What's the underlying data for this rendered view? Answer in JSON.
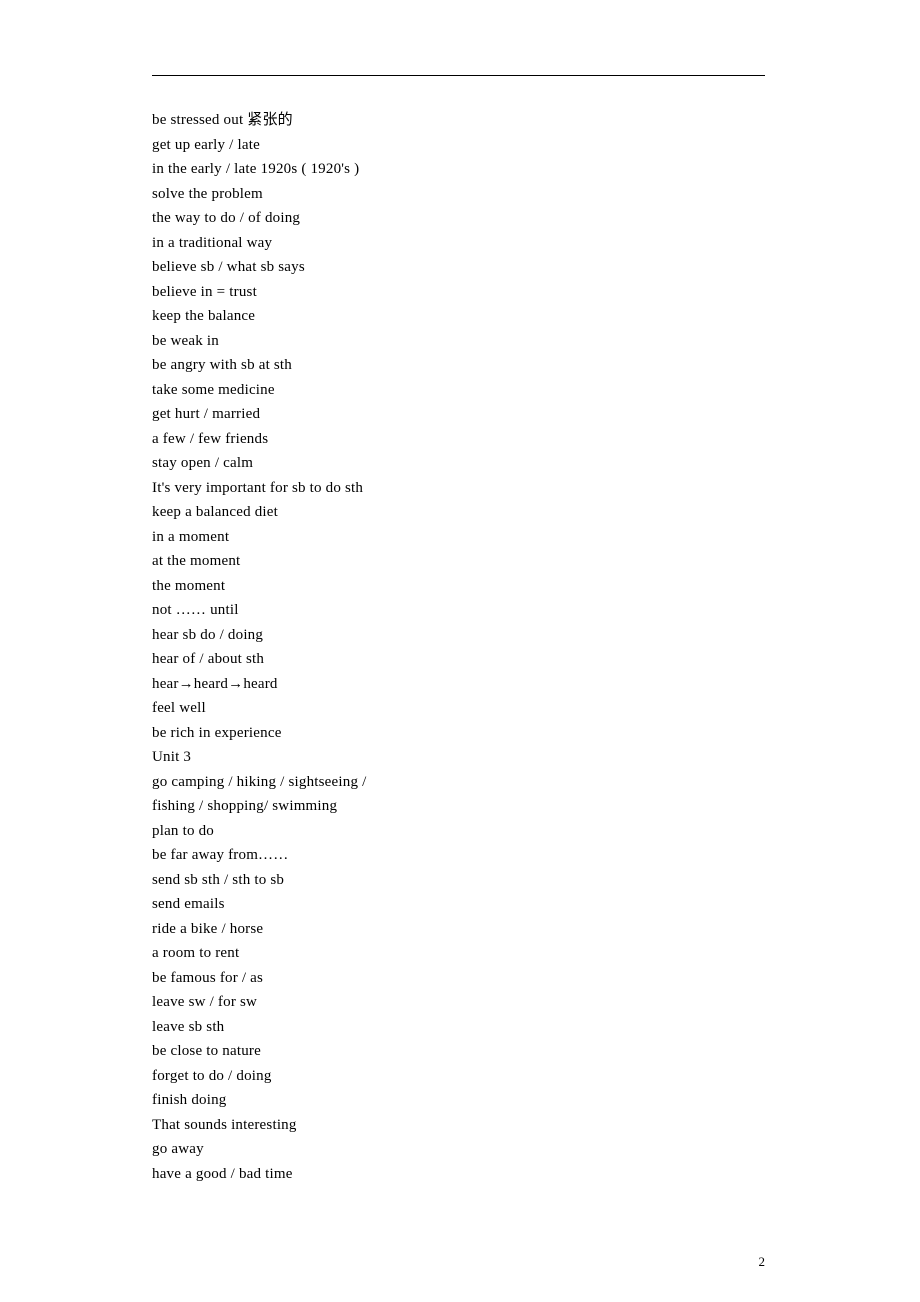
{
  "lines": [
    "be stressed out 紧张的",
    "get up early / late",
    "in the early / late 1920s ( 1920's )",
    "solve the problem",
    "the way to do / of doing",
    "in a traditional way",
    "believe sb / what sb says",
    "believe in = trust",
    "keep the balance",
    "be weak in",
    "be angry with sb at sth",
    "take some medicine",
    "get hurt / married",
    "a few / few friends",
    "stay open / calm",
    "It's very important for sb to do sth",
    "keep a balanced diet",
    "in a moment",
    "at the moment",
    "the moment",
    "not …… until",
    "hear sb do / doing",
    "hear of / about sth",
    "hear→heard→heard",
    "feel well",
    "be rich in experience",
    "Unit 3",
    "go camping / hiking / sightseeing /",
    "fishing / shopping/ swimming",
    "plan to do",
    "be far away from……",
    "send sb sth / sth to sb",
    "send emails",
    "ride a bike / horse",
    "a room to rent",
    "be famous for / as",
    "leave sw / for sw",
    "leave sb sth",
    "be close to nature",
    "forget to do / doing",
    "finish doing",
    "That sounds interesting",
    "go away",
    "have a good / bad time"
  ],
  "page_number": "2"
}
